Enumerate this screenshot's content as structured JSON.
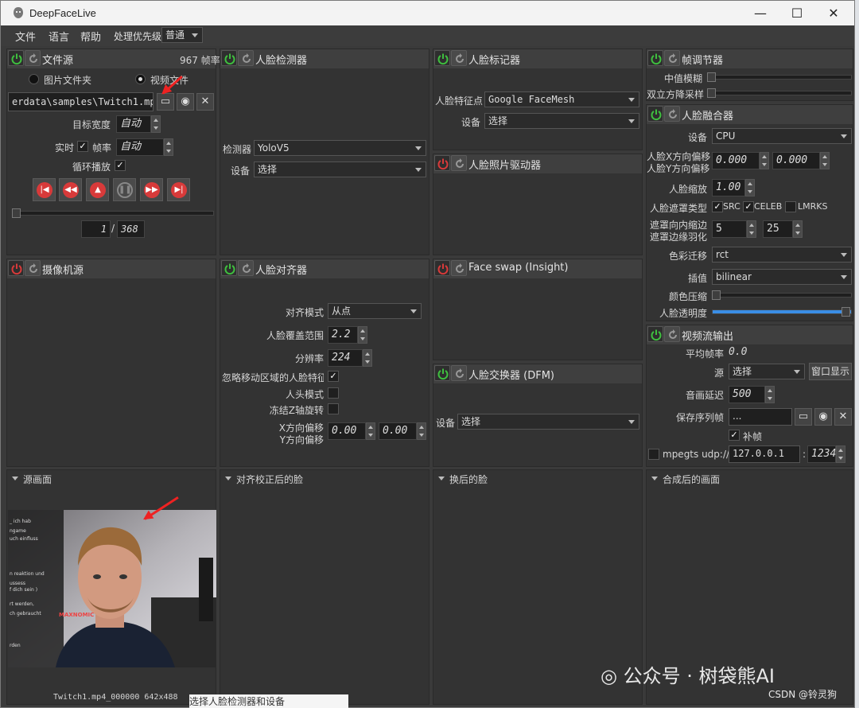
{
  "window": {
    "title": "DeepFaceLive",
    "minimize": "—",
    "maximize": "☐",
    "close": "✕"
  },
  "menubar": {
    "file": "文件",
    "language": "语言",
    "help": "帮助",
    "priority_label": "处理优先级",
    "priority_value": "普通"
  },
  "file_source": {
    "title": "文件源",
    "fps": "967 帧率",
    "radio_images": "图片文件夹",
    "radio_video": "视频文件",
    "selected": "视频文件",
    "path": "erdata\\samples\\Twitch1.mp4",
    "target_width_label": "目标宽度",
    "target_width_value": "自动",
    "realtime_label": "实时",
    "fps_label": "帧率",
    "fps_value": "自动",
    "loop_label": "循环播放",
    "frame_current": "1",
    "frame_sep": "/",
    "frame_total": "368"
  },
  "camera_source": {
    "title": "摄像机源"
  },
  "face_detector": {
    "title": "人脸检测器",
    "detector_label": "检测器",
    "detector_value": "YoloV5",
    "device_label": "设备",
    "device_value": "选择"
  },
  "face_aligner": {
    "title": "人脸对齐器",
    "mode_label": "对齐模式",
    "mode_value": "从点",
    "coverage_label": "人脸覆盖范围",
    "coverage_value": "2.2",
    "resolution_label": "分辨率",
    "resolution_value": "224",
    "exclude_moving_label": "忽略移动区域的人脸特征",
    "head_mode_label": "人头模式",
    "freeze_z_label": "冻结Z轴旋转",
    "x_offset_label": "X方向偏移",
    "y_offset_label": "Y方向偏移",
    "x_offset_value": "0.00",
    "y_offset_value": "0.00"
  },
  "face_marker": {
    "title": "人脸标记器",
    "marker_label": "人脸特征点",
    "marker_value": "Google FaceMesh",
    "device_label": "设备",
    "device_value": "选择"
  },
  "face_animator": {
    "title": "人脸照片驱动器"
  },
  "face_swap_insight": {
    "title": "Face swap (Insight)"
  },
  "face_swapper_dfm": {
    "title": "人脸交换器 (DFM)",
    "device_label": "设备",
    "device_value": "选择"
  },
  "frame_adjuster": {
    "title": "帧调节器",
    "median_blur_label": "中值模糊",
    "bilateral_label": "双立方降采样"
  },
  "face_merger": {
    "title": "人脸融合器",
    "device_label": "设备",
    "device_value": "CPU",
    "x_offset_label": "人脸X方向偏移",
    "y_offset_label": "人脸Y方向偏移",
    "x_offset_value": "0.000",
    "y_offset_value": "0.000",
    "scale_label": "人脸缩放",
    "scale_value": "1.00",
    "mask_type_label": "人脸遮罩类型",
    "mask_src": "SRC",
    "mask_celeb": "CELEB",
    "mask_lmrks": "LMRKS",
    "erode_label": "遮罩向内缩边",
    "blur_label": "遮罩边缘羽化",
    "erode_value": "5",
    "blur_value": "25",
    "color_transfer_label": "色彩迁移",
    "color_transfer_value": "rct",
    "interpolation_label": "插值",
    "interpolation_value": "bilinear",
    "color_compress_label": "颜色压缩",
    "opacity_label": "人脸透明度",
    "opacity_value": 1.0
  },
  "stream_output": {
    "title": "视频流输出",
    "avg_fps_label": "平均帧率",
    "avg_fps_value": "0.0",
    "source_label": "源",
    "source_value": "选择",
    "window_button": "窗口显示",
    "delay_label": "音画延迟",
    "delay_value": "500",
    "save_label": "保存序列帧",
    "save_value": "...",
    "fill_label": "补帧",
    "mpegts_label": "mpegts udp://",
    "mpegts_host": "127.0.0.1",
    "mpegts_sep": ":",
    "mpegts_port": "1234"
  },
  "viewers": {
    "source_frame": "源画面",
    "aligned_face": "对齐校正后的脸",
    "swapped_face": "换后的脸",
    "merged_frame": "合成后的画面",
    "source_caption": "Twitch1.mp4_000000 642x488"
  },
  "below_window_text": "选择人脸检测器和设备",
  "watermark": "公众号 · 树袋熊AI",
  "watermark_small": "CSDN @铃灵狗",
  "colors": {
    "power_on": "#3fbf3f",
    "power_off": "#d83a3a",
    "accent_arrow": "#ee2222"
  }
}
